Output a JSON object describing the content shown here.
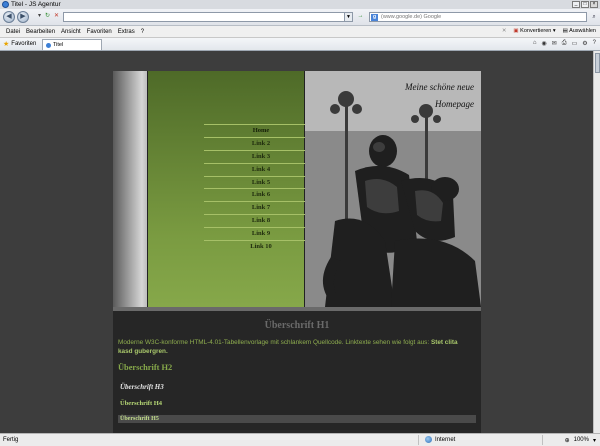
{
  "window": {
    "title": "Titel - JS Agentur"
  },
  "addressbar": {
    "url": "",
    "search_placeholder": "(www.google.de) Google"
  },
  "menubar": {
    "items": [
      "Datei",
      "Bearbeiten",
      "Ansicht",
      "Favoriten",
      "Extras",
      "?"
    ],
    "convert_label": "Konvertieren",
    "select_label": "Auswählen"
  },
  "favbar": {
    "favorites_label": "Favoriten",
    "tab_title": "Titel"
  },
  "site": {
    "header_line1": "Meine schöne neue",
    "header_line2": "Homepage",
    "nav": [
      "Home",
      "Link 2",
      "Link 3",
      "Link 4",
      "Link 5",
      "Link 6",
      "Link 7",
      "Link 8",
      "Link 9",
      "Link 10"
    ],
    "h1": "Überschrift H1",
    "paragraph_text": "Moderne W3C-konforme HTML-4.01-Tabellenvorlage mit schlankem Quellcode. Linktexte sehen wie folgt aus: ",
    "paragraph_link": "Stet clita kasd gubergren.",
    "h2": "Überschrift H2",
    "h3": "Überschrift H3",
    "h4": "Überschrift H4",
    "h5": "Überschrift H5"
  },
  "statusbar": {
    "status": "Fertig",
    "zone": "Internet",
    "zoom": "100%"
  }
}
